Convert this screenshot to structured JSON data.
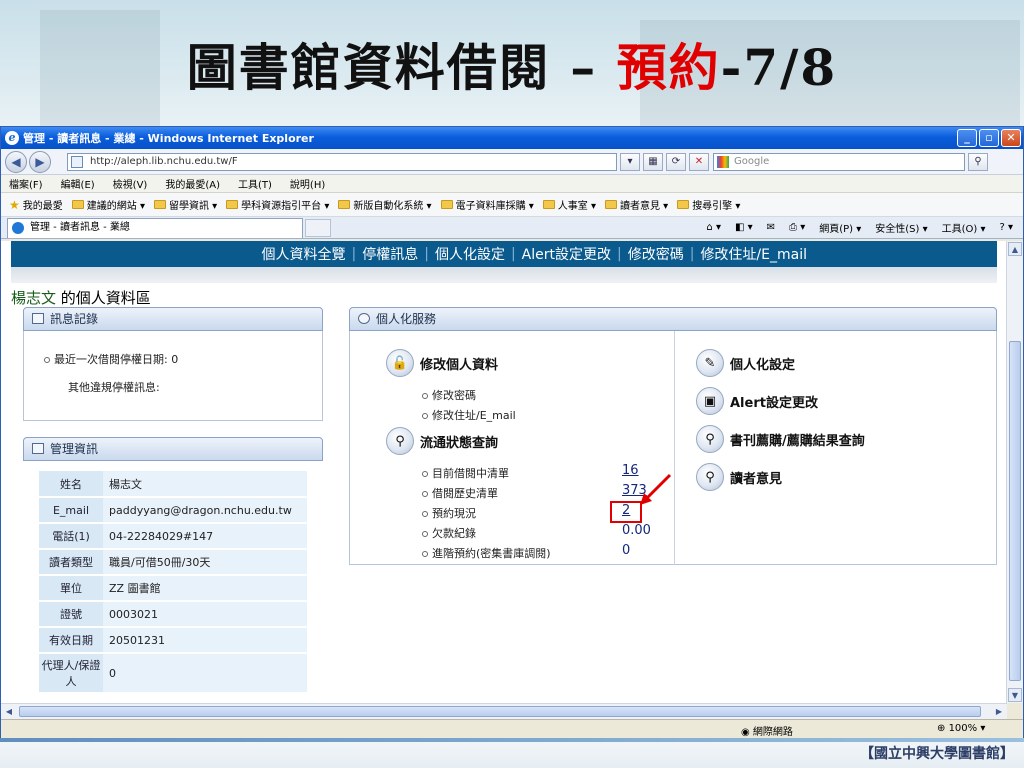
{
  "slide": {
    "title_main": "圖書館資料借閱 – ",
    "title_accent": "預約",
    "title_suffix": "-7/8"
  },
  "browser": {
    "window_title": "管理 - 讀者訊息 - 業總 - Windows Internet Explorer",
    "address": "http://aleph.lib.nchu.edu.tw/F",
    "search_placeholder": "Google",
    "menu": [
      "檔案(F)",
      "編輯(E)",
      "檢視(V)",
      "我的最愛(A)",
      "工具(T)",
      "說明(H)"
    ],
    "favorites_label": "我的最愛",
    "favorites": [
      "建議的網站 ▾",
      "留學資訊 ▾",
      "學科資源指引平台 ▾",
      "新版自動化系統 ▾",
      "電子資料庫採購 ▾",
      "人事室 ▾",
      "讀者意見 ▾",
      "搜尋引擎 ▾"
    ],
    "tab_title": "管理 - 讀者訊息 - 業總",
    "tab_tools": [
      "網頁(P) ▾",
      "安全性(S) ▾",
      "工具(O) ▾"
    ],
    "status_zone": "網際網路",
    "status_zoom": "100%"
  },
  "page": {
    "nav": [
      "個人資料全覽",
      "停權訊息",
      "個人化設定",
      "Alert設定更改",
      "修改密碼",
      "修改住址/E_mail"
    ],
    "user_name": "楊志文",
    "profile_suffix": " 的個人資料區",
    "msg_panel_title": "訊息記錄",
    "msg_line1": "最近一次借閱停權日期: 0",
    "msg_line2": "其他違規停權訊息:",
    "mgmt_panel_title": "管理資訊",
    "mgmt_rows": [
      {
        "label": "姓名",
        "value": "楊志文"
      },
      {
        "label": "E_mail",
        "value": "paddyyang@dragon.nchu.edu.tw"
      },
      {
        "label": "電話(1)",
        "value": "04-22284029#147"
      },
      {
        "label": "讀者類型",
        "value": "職員/可借50冊/30天"
      },
      {
        "label": "單位",
        "value": "ZZ 圖書館"
      },
      {
        "label": "證號",
        "value": "0003021"
      },
      {
        "label": "有效日期",
        "value": "20501231"
      },
      {
        "label": "代理人/保證人",
        "value": "0"
      }
    ],
    "svc_panel_title": "個人化服務",
    "svc_modify": "修改個人資料",
    "svc_modify_items": [
      "修改密碼",
      "修改住址/E_mail"
    ],
    "svc_status": "流通狀態查詢",
    "svc_status_items": [
      {
        "label": "目前借閱中清單",
        "count": "16"
      },
      {
        "label": "借閱歷史清單",
        "count": "373"
      },
      {
        "label": "預約現況",
        "count": "2"
      },
      {
        "label": "欠款紀錄",
        "count": "0.00"
      },
      {
        "label": "進階預約(密集書庫調閱)",
        "count": "0"
      }
    ],
    "svc_right": [
      "個人化設定",
      "Alert設定更改",
      "書刊薦購/薦購結果查詢",
      "讀者意見"
    ]
  },
  "footer": {
    "brand": "【國立中興大學圖書館】"
  },
  "colors": {
    "accent": "#e00000",
    "nav_bg": "#0b5a8e",
    "ie_blue": "#0a5ddc"
  }
}
